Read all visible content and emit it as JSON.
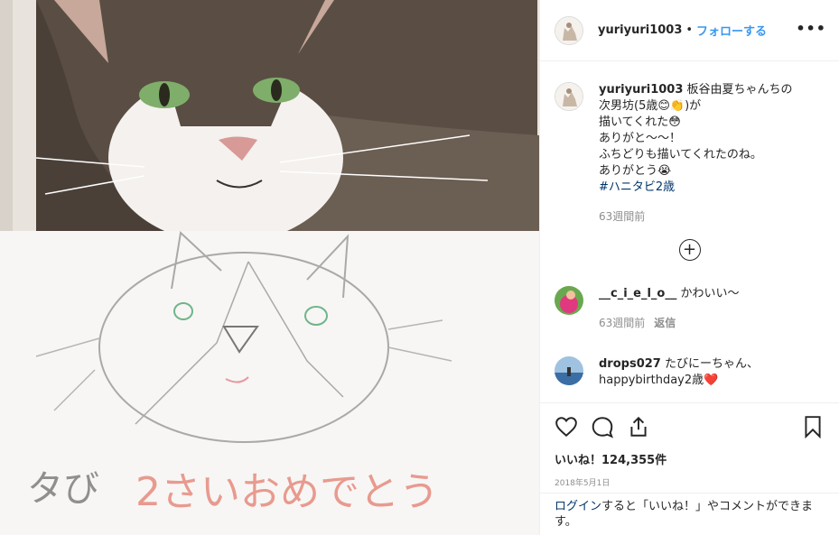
{
  "post": {
    "username": "yuriyuri1003",
    "follow_label": "フォローする",
    "dot": "•",
    "more_label": "•••"
  },
  "caption": {
    "username": "yuriyuri1003",
    "line1": "板谷由夏ちゃんちの",
    "line2": "次男坊(5歳😊👏)が",
    "line3": "描いてくれた😳",
    "line4": "ありがと〜〜！",
    "line5": "ふちどりも描いてくれたのね。",
    "line6": "ありがとう😭",
    "hashtag": "#ハニタビ2歳",
    "time": "63週間前",
    "load_more": "+"
  },
  "comments": [
    {
      "username": "__c_i_e_l_o__",
      "text": "かわいい〜",
      "time": "63週間前",
      "reply_label": "返信"
    },
    {
      "username": "drops027",
      "text": "たびにーちゃん、",
      "text2": "happybirthday2歳❤️"
    }
  ],
  "actions": {
    "likes_label": "いいね！124,355件",
    "date": "2018年5月1日"
  },
  "login": {
    "link": "ログイン",
    "text": "すると「いいね！」やコメントができます。"
  },
  "drawing": {
    "text_black": "タび",
    "text_red": "2さいおめでとう"
  },
  "colors": {
    "link_blue": "#3897f0",
    "hashtag_blue": "#003569",
    "muted_gray": "#8e8e8e",
    "border": "#efefef"
  }
}
